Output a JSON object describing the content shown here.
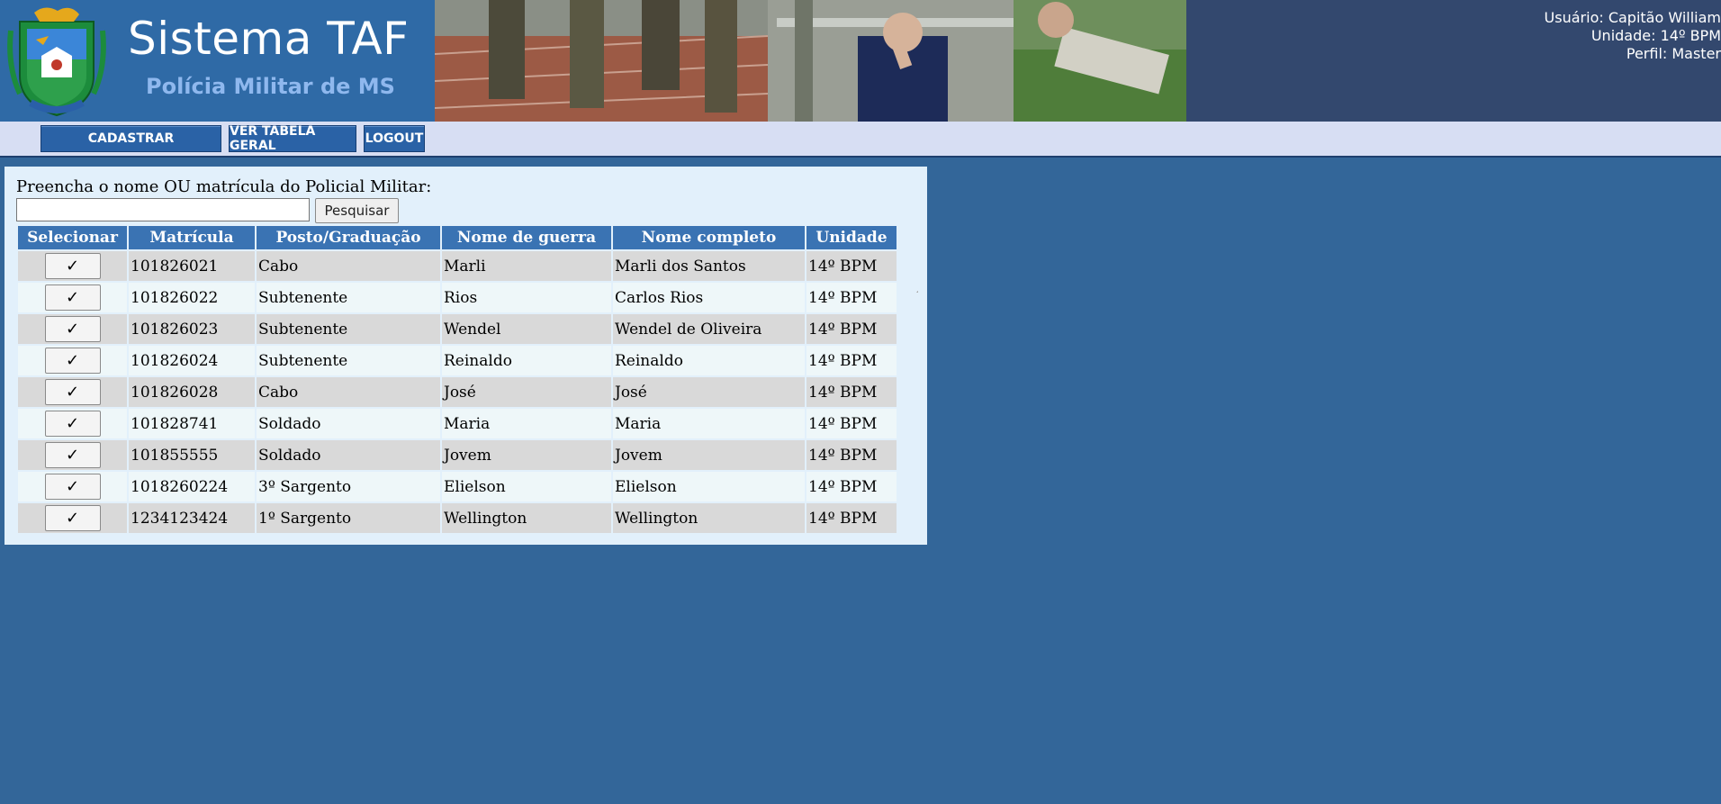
{
  "header": {
    "title": "Sistema TAF",
    "subtitle": "Polícia Militar de MS",
    "user_line": "Usuário: Capitão William",
    "unit_line": "Unidade: 14º BPM",
    "profile_line": "Perfil: Master"
  },
  "nav": {
    "cadastrar": "CADASTRAR",
    "tabela": "VER TABELA GERAL",
    "logout": "LOGOUT"
  },
  "search": {
    "label": "Preencha o nome OU matrícula do Policial Militar:",
    "value": "",
    "button": "Pesquisar"
  },
  "table": {
    "headers": [
      "Selecionar",
      "Matrícula",
      "Posto/Graduação",
      "Nome de guerra",
      "Nome completo",
      "Unidade"
    ],
    "select_glyph": "✓",
    "rows": [
      [
        "101826021",
        "Cabo",
        "Marli",
        "Marli dos Santos",
        "14º BPM"
      ],
      [
        "101826022",
        "Subtenente",
        "Rios",
        "Carlos Rios",
        "14º BPM"
      ],
      [
        "101826023",
        "Subtenente",
        "Wendel",
        "Wendel de Oliveira",
        "14º BPM"
      ],
      [
        "101826024",
        "Subtenente",
        "Reinaldo",
        "Reinaldo",
        "14º BPM"
      ],
      [
        "101826028",
        "Cabo",
        "José",
        "José",
        "14º BPM"
      ],
      [
        "101828741",
        "Soldado",
        "Maria",
        "Maria",
        "14º BPM"
      ],
      [
        "101855555",
        "Soldado",
        "Jovem",
        "Jovem",
        "14º BPM"
      ],
      [
        "1018260224",
        "3º Sargento",
        "Elielson",
        "Elielson",
        "14º BPM"
      ],
      [
        "1234123424",
        "1º Sargento",
        "Wellington",
        "Wellington",
        "14º BPM"
      ]
    ]
  },
  "colors": {
    "page_bg": "#336699",
    "header_bg": "#33486e",
    "brand_bg": "#2f6aa6",
    "nav_bg": "#d7def3",
    "nav_button": "#2a62a6",
    "panel_bg": "#e2f0fb",
    "table_header": "#3a73b3",
    "row_odd": "#d9d9d9",
    "row_even": "#eef7f9"
  }
}
